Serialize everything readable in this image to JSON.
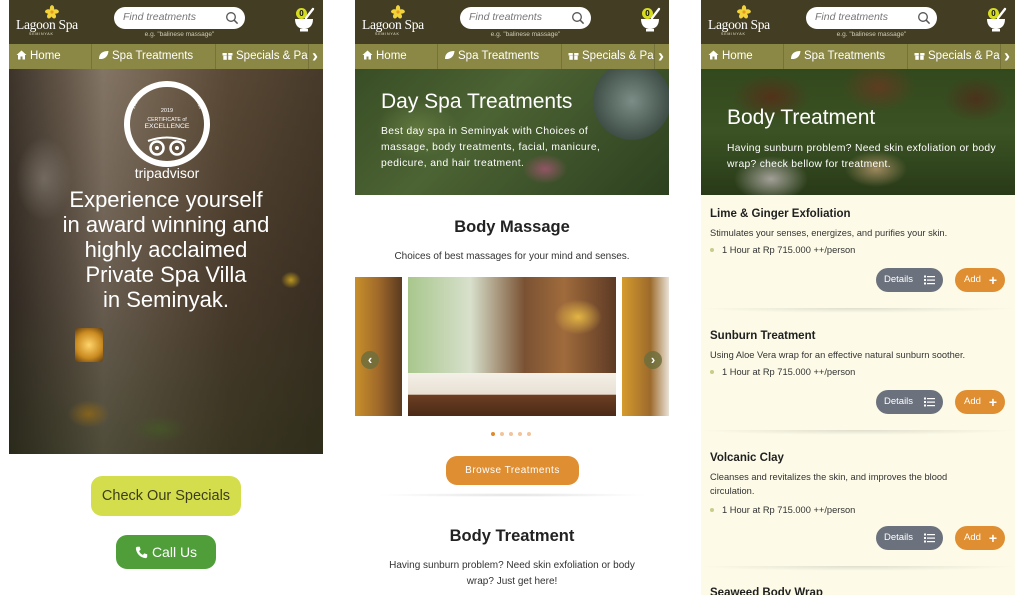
{
  "header": {
    "logo_text": "Lagoon Spa",
    "logo_sub": "SEMINYAK",
    "search_placeholder": "Find treatments",
    "search_hint": "e.g. \"balinese massage\"",
    "cart_count": "0"
  },
  "nav": {
    "items": [
      {
        "label": "Home",
        "icon": "home-icon"
      },
      {
        "label": "Spa Treatments",
        "icon": "leaf-icon"
      },
      {
        "label": "Specials & Pa",
        "icon": "gift-icon"
      }
    ],
    "more_arrow": "›"
  },
  "panel1": {
    "badge": {
      "year": "2019",
      "line1": "CERTIFICATE of",
      "line2": "EXCELLENCE",
      "ring": "2015 · 2016 · HALL of FAME · 2017 · 2018",
      "brand": "tripadvisor"
    },
    "headline": [
      "Experience yourself",
      "in award winning and",
      "highly acclaimed",
      "Private Spa Villa",
      "in Seminyak."
    ],
    "specials_button": "Check Our Specials",
    "call_button": "Call Us"
  },
  "panel2": {
    "hero_title": "Day Spa Treatments",
    "hero_sub": "Best day spa in Seminyak with Choices of massage, body treatments, facial, manicure, pedicure, and hair treatment.",
    "massage_title": "Body Massage",
    "massage_sub": "Choices of best massages for your mind and senses.",
    "carousel": {
      "prev": "‹",
      "next": "›",
      "dot_count": 5,
      "active_dot": 0
    },
    "browse_button": "Browse Treatments",
    "body_title": "Body Treatment",
    "body_sub_lines": [
      "Having sunburn problem? Need skin exfoliation or body",
      "wrap? Just get here!"
    ]
  },
  "panel3": {
    "hero_title": "Body Treatment",
    "hero_sub": "Having sunburn problem? Need skin exfoliation or body wrap? check bellow for treatment.",
    "details_label": "Details",
    "add_label": "Add",
    "items": [
      {
        "title": "Lime & Ginger Exfoliation",
        "desc": "Stimulates your senses, energizes, and purifies your skin.",
        "price": "1 Hour at Rp 715.000 ++/person"
      },
      {
        "title": "Sunburn Treatment",
        "desc": "Using Aloe Vera wrap for an effective natural sunburn soother.",
        "price": "1 Hour at Rp 715.000 ++/person"
      },
      {
        "title": "Volcanic Clay",
        "desc": "Cleanses and revitalizes the skin, and improves the blood circulation.",
        "price": "1 Hour at Rp 715.000 ++/person"
      },
      {
        "title": "Seaweed Body Wrap"
      }
    ]
  },
  "colors": {
    "header_bg": "#423d23",
    "nav_bg": "#8b8845",
    "accent_orange": "#df8e32",
    "specials_green": "#d4de4d",
    "call_green": "#4f9e3a",
    "details_gray": "#6c727d",
    "panel3_bg": "#fdfbe8"
  }
}
